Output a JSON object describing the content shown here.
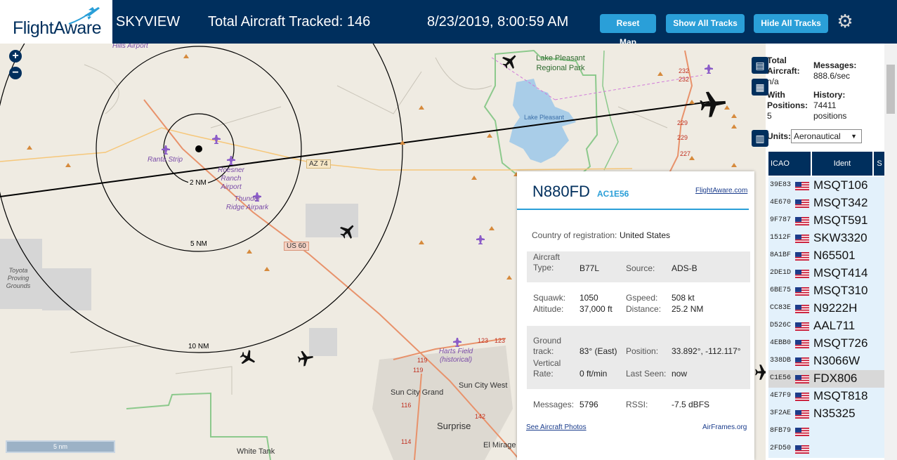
{
  "header": {
    "logo": "FlightAware",
    "app_name": "SKYVIEW",
    "total_tracked": "Total Aircraft Tracked: 146",
    "datetime": "8/23/2019, 8:00:59 AM",
    "btn_reset": "Reset Map",
    "btn_show": "Show All Tracks",
    "btn_hide": "Hide All Tracks"
  },
  "map": {
    "zoom_in": "+",
    "zoom_out": "−",
    "scale": "5 nm",
    "range_rings": [
      "2 NM",
      "5 NM",
      "10 NM"
    ],
    "places": [
      "Lake Pleasant Regional Park",
      "Lake Pleasant",
      "Sun City Grand",
      "Sun City West",
      "Surprise",
      "El Mirage",
      "White Tank",
      "Toyota Proving Grounds"
    ],
    "airports": [
      "Hills Airport",
      "Ranta Strip",
      "Roesner Ranch Airport",
      "Thunder Ridge Airpark",
      "Harts Field (historical)"
    ],
    "roads": [
      "AZ 74",
      "US 60"
    ],
    "road_numbers": [
      "232",
      "232",
      "229",
      "229",
      "227",
      "123",
      "123",
      "119",
      "119",
      "116",
      "114",
      "142"
    ]
  },
  "popup": {
    "callsign": "N880FD",
    "hex": "AC1E56",
    "fa_link": "FlightAware.com",
    "country_label": "Country of registration:",
    "country": "United States",
    "aircraft_type_label": "Aircraft Type:",
    "aircraft_type": "B77L",
    "source_label": "Source:",
    "source": "ADS-B",
    "squawk_label": "Squawk:",
    "squawk": "1050",
    "altitude_label": "Altitude:",
    "altitude": "37,000 ft",
    "gspeed_label": "Gspeed:",
    "gspeed": "508 kt",
    "distance_label": "Distance:",
    "distance": "25.2 NM",
    "track_label": "Ground track:",
    "track": "83° (East)",
    "position_label": "Position:",
    "position": "33.892°, -112.117°",
    "vrate_label": "Vertical Rate:",
    "vrate": "0 ft/min",
    "lastseen_label": "Last Seen:",
    "lastseen": "now",
    "messages_label": "Messages:",
    "messages": "5796",
    "rssi_label": "RSSI:",
    "rssi": "-7.5 dBFS",
    "photos_link": "See Aircraft Photos",
    "airframes_link": "AirFrames.org"
  },
  "sidebar": {
    "total_label": "Total Aircraft:",
    "total_value": "n/a",
    "messages_label": "Messages:",
    "messages_value": "888.6/sec",
    "positions_label": "With Positions:",
    "positions_value": "5",
    "history_label": "History:",
    "history_value": "74411 positions",
    "units_label": "Units:",
    "units_value": "Aeronautical",
    "col_icao": "ICAO",
    "col_ident": "Ident",
    "col_squawk": "S",
    "rows": [
      {
        "icao": "39E83",
        "ident": "MSQT106"
      },
      {
        "icao": "4E670",
        "ident": "MSQT342"
      },
      {
        "icao": "9F787",
        "ident": "MSQT591"
      },
      {
        "icao": "1512F",
        "ident": "SKW3320"
      },
      {
        "icao": "8A1BF",
        "ident": "N65501"
      },
      {
        "icao": "2DE1D",
        "ident": "MSQT414"
      },
      {
        "icao": "6BE75",
        "ident": "MSQT310"
      },
      {
        "icao": "CC83E",
        "ident": "N9222H"
      },
      {
        "icao": "D526C",
        "ident": "AAL711"
      },
      {
        "icao": "4EBB0",
        "ident": "MSQT726"
      },
      {
        "icao": "338DB",
        "ident": "N3066W"
      },
      {
        "icao": "C1E56",
        "ident": "FDX806"
      },
      {
        "icao": "4E7F9",
        "ident": "MSQT818"
      },
      {
        "icao": "3F2AE",
        "ident": "N35325"
      },
      {
        "icao": "8FB79",
        "ident": ""
      },
      {
        "icao": "2FD50",
        "ident": ""
      }
    ]
  }
}
